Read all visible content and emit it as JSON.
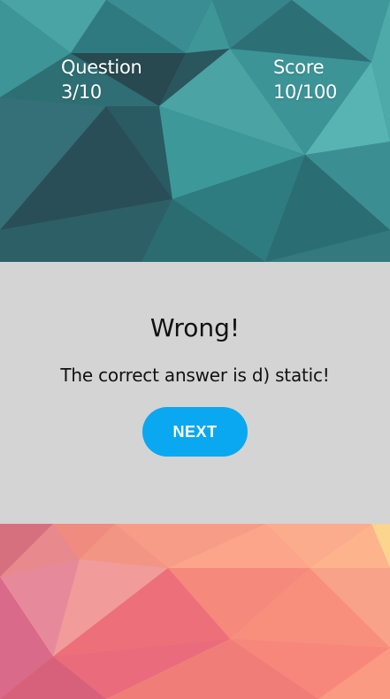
{
  "header": {
    "question_label": "Question",
    "question_value": "3/10",
    "score_label": "Score",
    "score_value": "10/100"
  },
  "result": {
    "title": "Wrong!",
    "message": "The correct answer is d) static!",
    "next_label": "NEXT"
  },
  "colors": {
    "top_background": "#2f6e74",
    "result_background": "#d4d4d4",
    "bottom_background": "#f48a7a",
    "next_button": "#0aa8f0"
  }
}
